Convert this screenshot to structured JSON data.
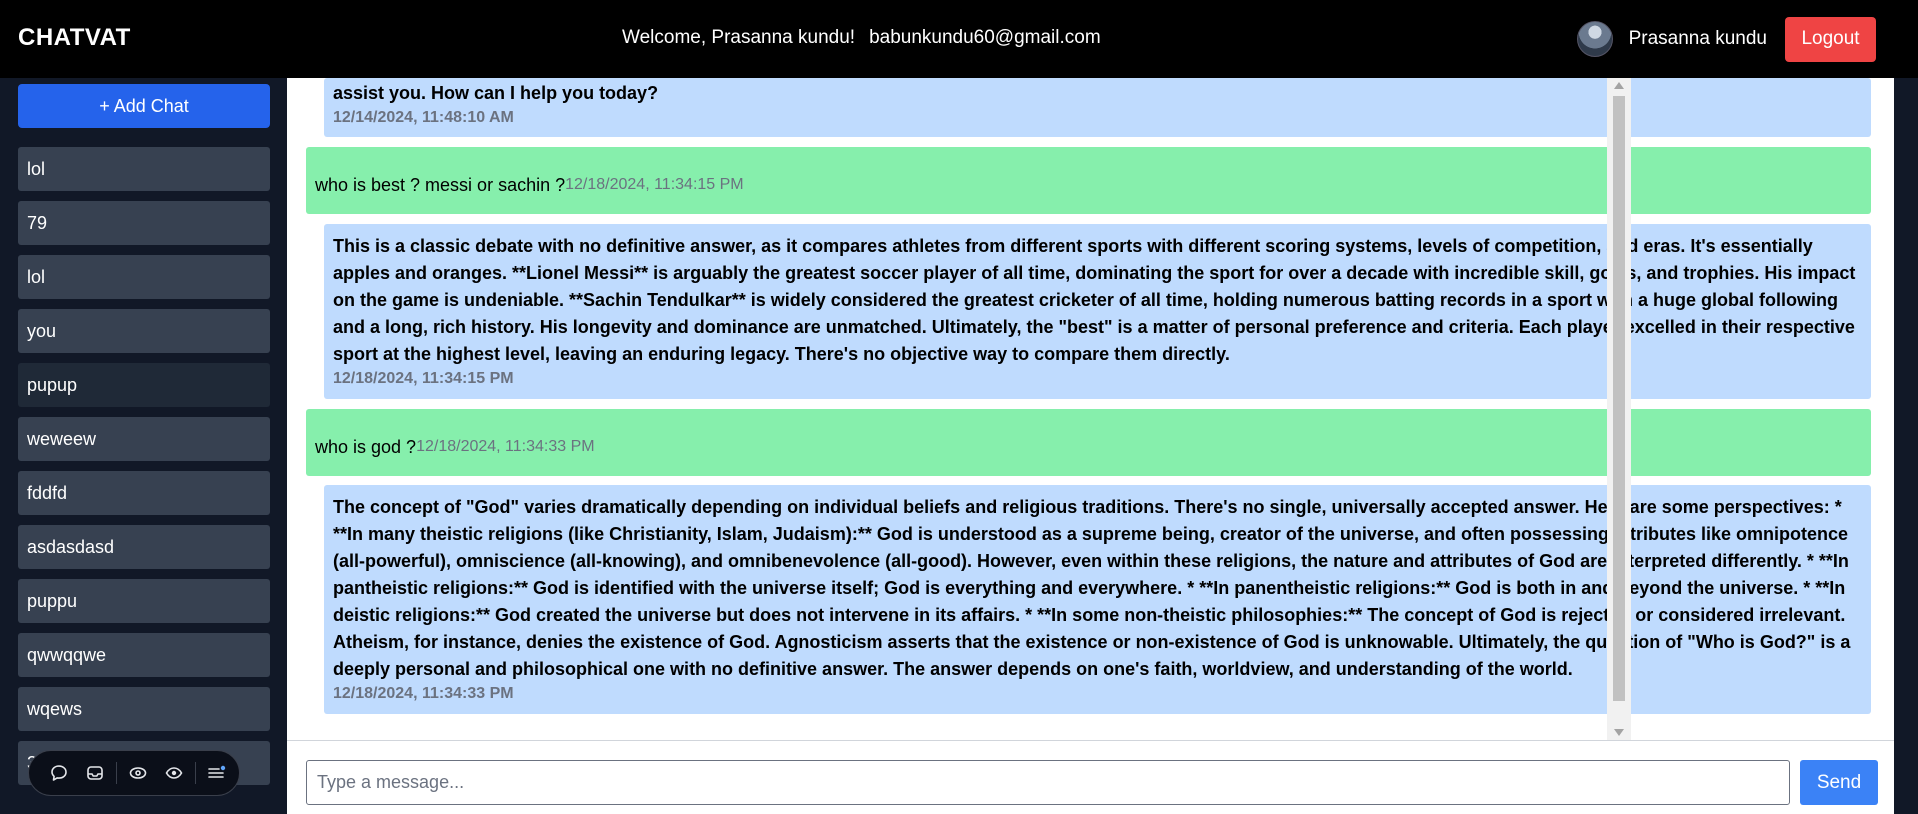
{
  "header": {
    "brand": "CHATVAT",
    "welcome": "Welcome, Prasanna kundu!",
    "email": "babunkundu60@gmail.com",
    "username": "Prasanna kundu",
    "logout_label": "Logout"
  },
  "sidebar": {
    "add_chat_label": "+ Add Chat",
    "items": [
      {
        "label": "lol"
      },
      {
        "label": "79"
      },
      {
        "label": "lol"
      },
      {
        "label": "you"
      },
      {
        "label": "pupup"
      },
      {
        "label": "weweew"
      },
      {
        "label": "fddfd"
      },
      {
        "label": "asdasdasd"
      },
      {
        "label": "puppu"
      },
      {
        "label": "qwwqqwe"
      },
      {
        "label": "wqews"
      },
      {
        "label": "3"
      }
    ]
  },
  "messages": [
    {
      "role": "bot",
      "text": "assist you. How can I help you today?",
      "time": "12/14/2024, 11:48:10 AM"
    },
    {
      "role": "user",
      "text": "who is best ? messi or sachin ?",
      "time": "12/18/2024, 11:34:15 PM"
    },
    {
      "role": "bot",
      "text": "This is a classic debate with no definitive answer, as it compares athletes from different sports with different scoring systems, levels of competition, and eras. It's essentially apples and oranges. **Lionel Messi** is arguably the greatest soccer player of all time, dominating the sport for over a decade with incredible skill, goals, and trophies. His impact on the game is undeniable. **Sachin Tendulkar** is widely considered the greatest cricketer of all time, holding numerous batting records in a sport with a huge global following and a long, rich history. His longevity and dominance are unmatched. Ultimately, the \"best\" is a matter of personal preference and criteria. Each player excelled in their respective sport at the highest level, leaving an enduring legacy. There's no objective way to compare them directly.",
      "time": "12/18/2024, 11:34:15 PM"
    },
    {
      "role": "user",
      "text": "who is god ?",
      "time": "12/18/2024, 11:34:33 PM"
    },
    {
      "role": "bot",
      "text": "The concept of \"God\" varies dramatically depending on individual beliefs and religious traditions. There's no single, universally accepted answer. Here are some perspectives: * **In many theistic religions (like Christianity, Islam, Judaism):** God is understood as a supreme being, creator of the universe, and often possessing attributes like omnipotence (all-powerful), omniscience (all-knowing), and omnibenevolence (all-good). However, even within these religions, the nature and attributes of God are interpreted differently. * **In pantheistic religions:** God is identified with the universe itself; God is everything and everywhere. * **In panentheistic religions:** God is both in and beyond the universe. * **In deistic religions:** God created the universe but does not intervene in its affairs. * **In some non-theistic philosophies:** The concept of God is rejected or considered irrelevant. Atheism, for instance, denies the existence of God. Agnosticism asserts that the existence or non-existence of God is unknowable. Ultimately, the question of \"Who is God?\" is a deeply personal and philosophical one with no definitive answer. The answer depends on one's faith, worldview, and understanding of the world.",
      "time": "12/18/2024, 11:34:33 PM"
    }
  ],
  "composer": {
    "placeholder": "Type a message...",
    "send_label": "Send"
  },
  "icons": {
    "floating_bar": [
      "chat-bubble-icon",
      "inbox-icon",
      "eye-outline-icon",
      "eye-icon",
      "menu-icon"
    ]
  },
  "colors": {
    "header_bg": "#000000",
    "sidebar_bg": "#111827",
    "add_chat": "#2563eb",
    "chat_item": "#374151",
    "user_bubble": "#86efac",
    "bot_bubble": "#bfdbfe",
    "logout": "#ef4444",
    "send": "#3b82f6"
  }
}
